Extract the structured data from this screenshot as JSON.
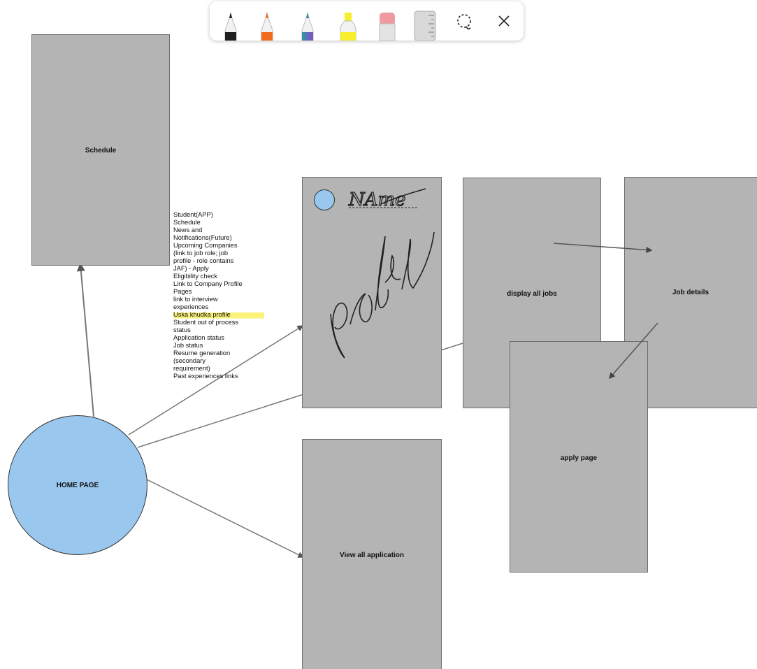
{
  "toolbar": {
    "tools": [
      {
        "name": "black-pen",
        "color": "#1f1f1f"
      },
      {
        "name": "orange-pen",
        "color": "#f06a1e"
      },
      {
        "name": "galaxy-pen",
        "color": "#5a6fc0"
      },
      {
        "name": "yellow-highlighter",
        "color": "#f7ee2c"
      },
      {
        "name": "eraser",
        "color": "#ef9aa0"
      },
      {
        "name": "ruler",
        "color": "#d9d9d9"
      },
      {
        "name": "lasso-select-icon"
      },
      {
        "name": "close-icon"
      }
    ]
  },
  "diagram": {
    "home_page": "HOME PAGE",
    "schedule": "Schedule",
    "profile_box": {
      "name_handwriting": "NAme",
      "profile_handwriting": "profile"
    },
    "display_all_jobs": "display all jobs",
    "job_details": "Job details",
    "apply_page": "apply page",
    "view_all_application": "View all application",
    "notes": [
      "Student(APP)",
      "Schedule",
      "News and",
      "Notifications(Future)",
      "Upcoming Companies",
      "(link to job role; job",
      "profile - role contains",
      "JAF) - Apply",
      "Eligibility check",
      "Link to Company Profile",
      "Pages",
      "link to interview",
      "experiences",
      "Uska khudka profile",
      "Student out of process",
      "status",
      "Application status",
      "Job status",
      "Resume generation",
      "(secondary",
      "requirement)",
      "Past experiences links"
    ],
    "highlighted_note_index": 13,
    "colors": {
      "box_fill": "#b4b4b4",
      "circle_fill": "#99c7ee",
      "highlight": "#fbf27a"
    }
  }
}
